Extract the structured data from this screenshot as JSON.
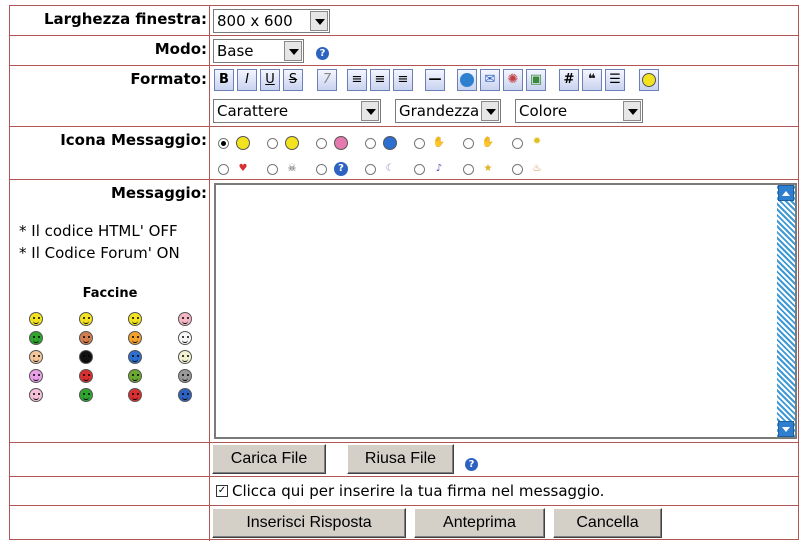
{
  "labels": {
    "larghezza": "Larghezza finestra:",
    "modo": "Modo:",
    "formato": "Formato:",
    "icona": "Icona Messaggio:",
    "messaggio": "Messaggio:"
  },
  "larghezza": {
    "value": "800 x 600"
  },
  "modo": {
    "value": "Base"
  },
  "formato": {
    "toolbar": [
      "B",
      "I",
      "U",
      "S",
      "italic-script-icon",
      "align-left-icon",
      "align-center-icon",
      "align-right-icon",
      "horizontal-rule-icon",
      "globe-link-icon",
      "email-icon",
      "image-icon",
      "picture-icon",
      "code-icon",
      "quote-icon",
      "list-icon",
      "smiley-icon"
    ],
    "carattere": "Carattere",
    "grandezza": "Grandezza",
    "colore": "Colore"
  },
  "icons_row1": [
    "smile",
    "clown",
    "shocked",
    "sad",
    "thumbs-down",
    "thumbs-up",
    "lightbulb"
  ],
  "icons_row2": [
    "heart",
    "skull",
    "question",
    "moon",
    "music",
    "star",
    "cake"
  ],
  "side": {
    "html_off": "* Il codice HTML' OFF",
    "forum_on": "* Il Codice Forum' ON",
    "faccine": "Faccine"
  },
  "faces": [
    "#f2e21f",
    "#f2e21f",
    "#f2e21f",
    "#f5b7c4",
    "#2fa530",
    "#d07d4f",
    "#f2a22a",
    "#f7f7f7",
    "#f2c69a",
    "#111111",
    "#2c6fd0",
    "#f2f2d0",
    "#e8a0e8",
    "#d83030",
    "#6aa830",
    "#999999",
    "#f5c0d8",
    "#2fa530",
    "#d83030",
    "#2d63c0"
  ],
  "buttons": {
    "carica": "Carica File",
    "riusa": "Riusa File",
    "inserisci": "Inserisci Risposta",
    "anteprima": "Anteprima",
    "cancella": "Cancella"
  },
  "firma": "Clicca qui per inserire la tua firma nel messaggio.",
  "colors": {
    "border": "#b25555",
    "help": "#2d63c0",
    "scrollbar": "#3d9ad6"
  }
}
